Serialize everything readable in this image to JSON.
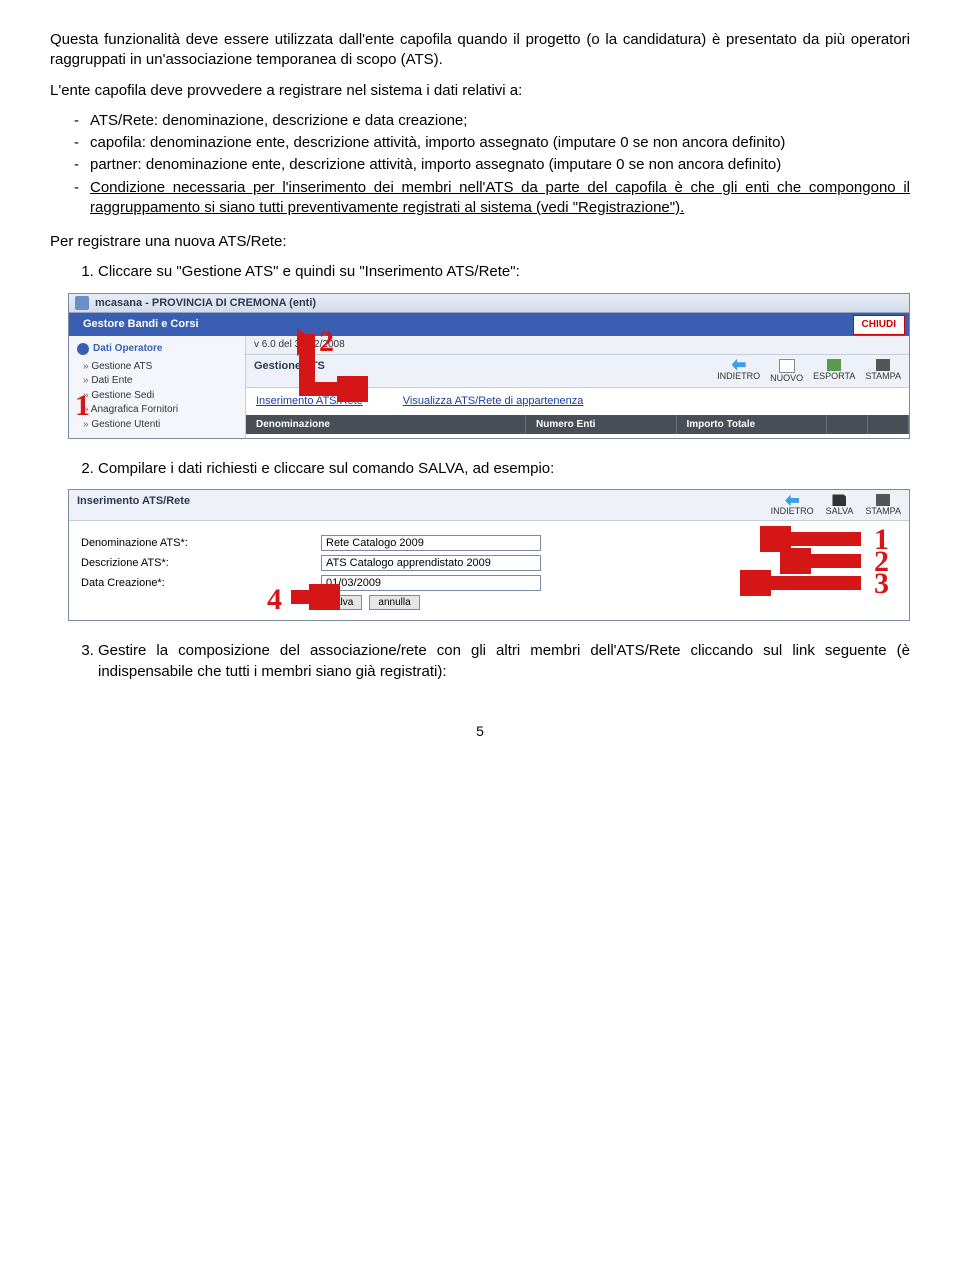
{
  "intro1": "Questa funzionalità deve essere utilizzata dall'ente capofila quando il progetto (o la candidatura) è presentato da più operatori raggruppati in un'associazione temporanea di scopo (ATS).",
  "intro2": "L'ente capofila deve provvedere a registrare nel sistema i dati relativi a:",
  "bullets": {
    "b1": "ATS/Rete: denominazione, descrizione e data creazione;",
    "b2": "capofila: denominazione ente, descrizione attività, importo assegnato (imputare 0 se non ancora definito)",
    "b3": "partner: denominazione ente, descrizione attività, importo assegnato (imputare 0 se non ancora definito)",
    "b4": "Condizione necessaria per l'inserimento dei membri nell'ATS da parte del capofila è che gli enti che compongono il raggruppamento si siano tutti preventivamente registrati al sistema (vedi \"Registrazione\")."
  },
  "perreg": "Per registrare una nuova ATS/Rete:",
  "steps": {
    "s1": "Cliccare su \"Gestione ATS\" e quindi su \"Inserimento ATS/Rete\":",
    "s2": "Compilare i dati richiesti e cliccare sul comando SALVA, ad esempio:",
    "s3": "Gestire la composizione del associazione/rete con gli altri membri dell'ATS/Rete cliccando sul link seguente (è indispensabile che tutti i membri siano già registrati):"
  },
  "shot1": {
    "titlebar": "mcasana - PROVINCIA DI CREMONA (enti)",
    "toptab": "Gestore Bandi e Corsi",
    "chiudi": "CHIUDI",
    "version": "v 6.0 del 31/12/2008",
    "sidehdr": "Dati Operatore",
    "side": {
      "i1": "Gestione ATS",
      "i2": "Dati Ente",
      "i3": "Gestione Sedi",
      "i4": "Anagrafica Fornitori",
      "i5": "Gestione Utenti"
    },
    "section": "Gestione ATS",
    "tb": {
      "back": "INDIETRO",
      "new": "NUOVO",
      "exp": "ESPORTA",
      "pr": "STAMPA"
    },
    "link1": "Inserimento ATS/Rete",
    "link2": "Visualizza ATS/Rete di appartenenza",
    "cols": {
      "c1": "Denominazione",
      "c2": "Numero Enti",
      "c3": "Importo Totale"
    },
    "num1": "1",
    "num2": "2"
  },
  "shot2": {
    "title": "Inserimento ATS/Rete",
    "tb": {
      "back": "INDIETRO",
      "save": "SALVA",
      "pr": "STAMPA"
    },
    "lab1": "Denominazione ATS*:",
    "val1": "Rete Catalogo 2009",
    "lab2": "Descrizione ATS*:",
    "val2": "ATS Catalogo apprendistato 2009",
    "lab3": "Data Creazione*:",
    "val3": "01/03/2009",
    "btn1": "salva",
    "btn2": "annulla",
    "num1": "1",
    "num2": "2",
    "num3": "3",
    "num4": "4"
  },
  "pagenum": "5"
}
